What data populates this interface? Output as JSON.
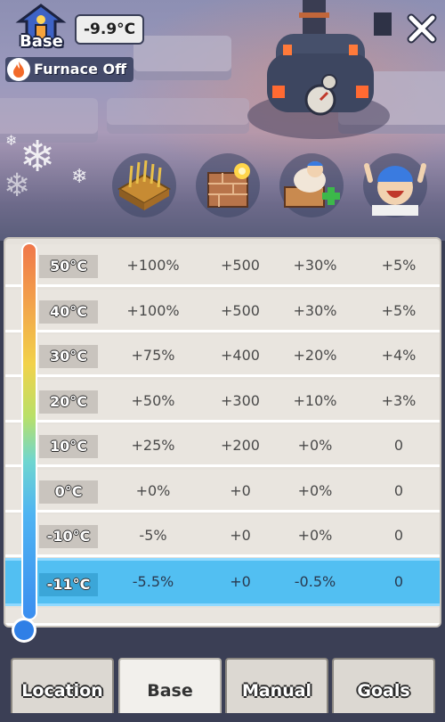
{
  "hud": {
    "base_label": "Base",
    "temperature": "-9.9°C",
    "furnace_status": "Furnace Off"
  },
  "effect_columns": [
    {
      "icon": "wheat-crate-icon"
    },
    {
      "icon": "exploding-wall-icon"
    },
    {
      "icon": "sick-worker-heal-icon"
    },
    {
      "icon": "cheering-worker-icon"
    }
  ],
  "table": {
    "rows": [
      {
        "temp": "50°C",
        "v1": "+100%",
        "v2": "+500",
        "v3": "+30%",
        "v4": "+5%"
      },
      {
        "temp": "40°C",
        "v1": "+100%",
        "v2": "+500",
        "v3": "+30%",
        "v4": "+5%"
      },
      {
        "temp": "30°C",
        "v1": "+75%",
        "v2": "+400",
        "v3": "+20%",
        "v4": "+4%"
      },
      {
        "temp": "20°C",
        "v1": "+50%",
        "v2": "+300",
        "v3": "+10%",
        "v4": "+3%"
      },
      {
        "temp": "10°C",
        "v1": "+25%",
        "v2": "+200",
        "v3": "+0%",
        "v4": "0"
      },
      {
        "temp": "0°C",
        "v1": "+0%",
        "v2": "+0",
        "v3": "+0%",
        "v4": "0"
      },
      {
        "temp": "-10°C",
        "v1": "-5%",
        "v2": "+0",
        "v3": "+0%",
        "v4": "0"
      },
      {
        "temp": "-11°C",
        "v1": "-5.5%",
        "v2": "+0",
        "v3": "-0.5%",
        "v4": "0"
      }
    ],
    "current_row_index": 7
  },
  "tabs": [
    {
      "label": "Location"
    },
    {
      "label": "Base",
      "active": true
    },
    {
      "label": "Manual"
    },
    {
      "label": "Goals"
    }
  ],
  "colors": {
    "highlight_row": "#52bff2",
    "panel_bg": "#e6e2dc"
  }
}
